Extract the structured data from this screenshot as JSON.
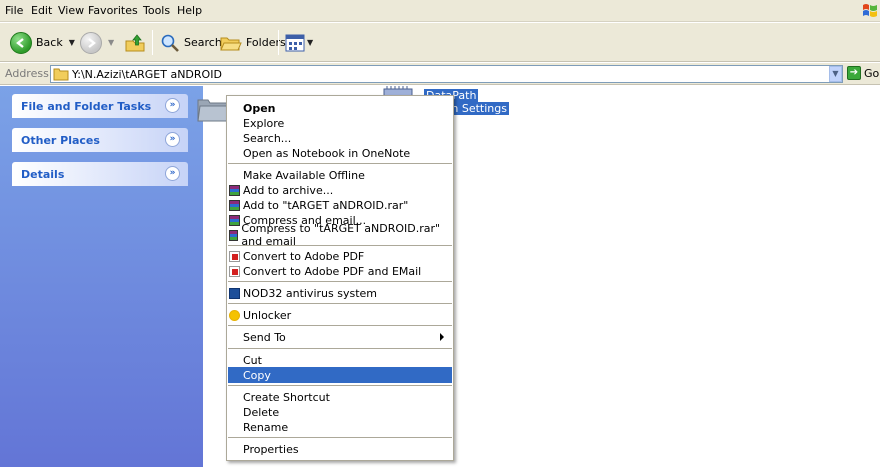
{
  "menubar": {
    "items": [
      "File",
      "Edit",
      "View",
      "Favorites",
      "Tools",
      "Help"
    ]
  },
  "toolbar": {
    "back_label": "Back",
    "search_label": "Search",
    "folders_label": "Folders"
  },
  "address": {
    "label": "Address",
    "value": "Y:\\N.Azizi\\tARGET aNDROID",
    "go_label": "Go"
  },
  "taskpane": {
    "panels": [
      "File and Folder Tasks",
      "Other Places",
      "Details"
    ]
  },
  "files": {
    "datapath_name": "DataPath",
    "datapath_type": "ration Settings"
  },
  "context_menu": {
    "items": [
      "Open",
      "Explore",
      "Search...",
      "Open as Notebook in OneNote",
      "Make Available Offline",
      "Add to archive...",
      "Add to \"tARGET aNDROID.rar\"",
      "Compress and email...",
      "Compress to \"tARGET aNDROID.rar\" and email",
      "Convert to Adobe PDF",
      "Convert to Adobe PDF and EMail",
      "NOD32 antivirus system",
      "Unlocker",
      "Send To",
      "Cut",
      "Copy",
      "Create Shortcut",
      "Delete",
      "Rename",
      "Properties"
    ],
    "highlighted": "Copy"
  },
  "colors": {
    "chrome": "#ece9d8",
    "selection": "#316ac5",
    "taskpane_top": "#7ba2e7",
    "taskpane_bottom": "#6375d6",
    "panel_title": "#215dc6"
  }
}
